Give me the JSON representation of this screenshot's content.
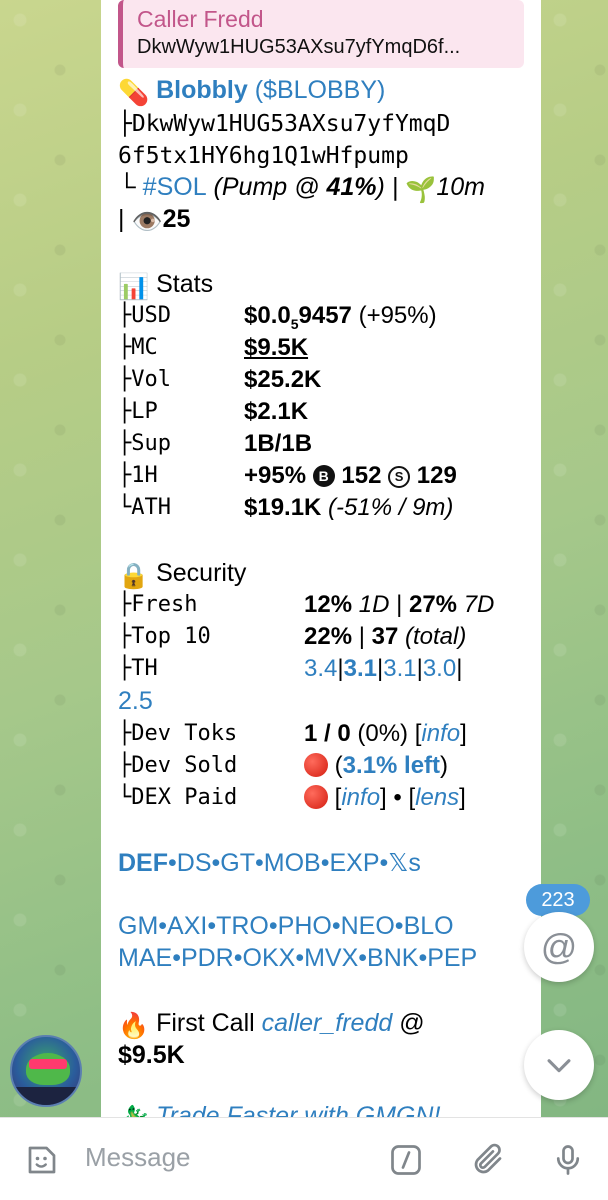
{
  "reply": {
    "name": "Caller Fredd",
    "address": "DkwWyw1HUG53AXsu7yfYmqD6f..."
  },
  "token": {
    "pill_icon": "💊",
    "name": "Blobbly",
    "symbol_open": " (",
    "symbol": "$BLOBBY",
    "symbol_close": ")",
    "addr_prefix": "├",
    "addr_line1": "DkwWyw1HUG53AXsu7yfYmqD",
    "addr_line2": "6f5tx1HY6hg1Q1wHfpump",
    "chain_prefix": "└ ",
    "chain": "#SOL",
    "pump_pre": " (Pump @ ",
    "pump_pct": "41%",
    "pump_post": ") | ",
    "age_icon": "🌱",
    "age": "10m",
    "views_prefix": "| ",
    "views_icon": "👁️",
    "views": "25"
  },
  "stats": {
    "icon": "📊",
    "title": "Stats",
    "rows": [
      {
        "prefix": "├",
        "label": "USD"
      },
      {
        "prefix": "├",
        "label": "MC"
      },
      {
        "prefix": "├",
        "label": "Vol"
      },
      {
        "prefix": "├",
        "label": "LP"
      },
      {
        "prefix": "├",
        "label": "Sup"
      },
      {
        "prefix": "├",
        "label": "1H"
      },
      {
        "prefix": "└",
        "label": "ATH"
      }
    ],
    "usd_main": "$0.0",
    "usd_sub": "5",
    "usd_rest": "9457",
    "usd_change": " (+95%)",
    "mc": "$9.5K",
    "vol": "$25.2K",
    "lp": "$2.1K",
    "sup": "1B/1B",
    "h1_change": "+95% ",
    "h1_buy_icon": "B",
    "h1_buys": " 152 ",
    "h1_sell_icon": "S",
    "h1_sells": " 129",
    "ath_value": "$19.1K",
    "ath_detail": " (-51% / 9m)"
  },
  "security": {
    "icon": "🔒",
    "title": "Security",
    "fresh_label": "Fresh",
    "fresh_1d": "12%",
    "fresh_1d_unit": " 1D",
    "fresh_sep": " | ",
    "fresh_7d": "27%",
    "fresh_7d_unit": " 7D",
    "top10_label": "Top 10",
    "top10_pct": "22%",
    "top10_sep": " | ",
    "top10_count": "37",
    "top10_total": " (total)",
    "th_label": "TH",
    "th_values": [
      "3.4",
      "3.1",
      "3.1",
      "3.0"
    ],
    "th_wrap": "2.5",
    "dev_toks_label": "Dev Toks",
    "dev_toks_value": "1 / 0",
    "dev_toks_pct": " (0%)  [",
    "dev_toks_info": "info",
    "dev_toks_close": "]",
    "dev_sold_label": "Dev Sold",
    "dev_sold_left": "3.1% left",
    "dex_paid_label": "DEX Paid",
    "dex_info": "info",
    "dex_lens": "lens"
  },
  "links": {
    "row1": [
      "DEF",
      "DS",
      "GT",
      "MOB",
      "EXP",
      "𝕏s"
    ],
    "row2": [
      "GM",
      "AXI",
      "TRO",
      "PHO",
      "NEO",
      "BLO"
    ],
    "row3": [
      "MAE",
      "PDR",
      "OKX",
      "MVX",
      "BNK",
      "PEP"
    ],
    "sep": "•"
  },
  "first_call": {
    "icon": "🔥",
    "label": " First Call ",
    "caller": "caller_fredd",
    "at": " @",
    "value": "$9.5K"
  },
  "promo": {
    "text": "Trade Faster with GMGN!"
  },
  "ui": {
    "unread_count": "223",
    "mention_icon": "@",
    "placeholder": "Message"
  },
  "colors": {
    "link": "#2f7fbf",
    "reply_accent": "#c2568a",
    "badge": "#4d9bdb"
  }
}
